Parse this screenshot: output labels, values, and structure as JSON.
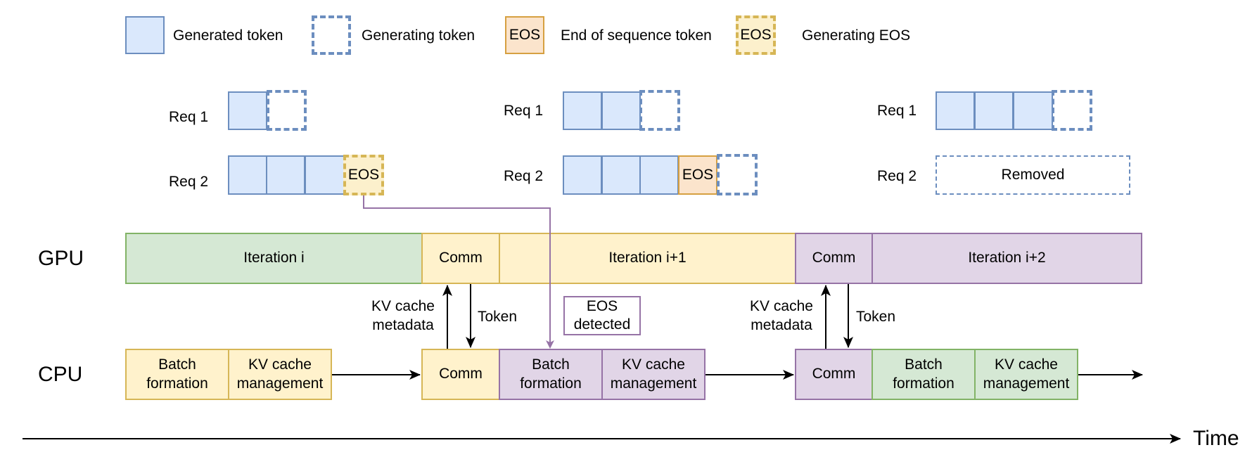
{
  "legend": {
    "items": [
      {
        "symbol_text": "",
        "label": "Generated token"
      },
      {
        "symbol_text": "",
        "label": "Generating token"
      },
      {
        "symbol_text": "EOS",
        "label": "End of sequence token"
      },
      {
        "symbol_text": "EOS",
        "label": "Generating EOS"
      }
    ]
  },
  "snapshots": [
    {
      "req1": {
        "label": "Req 1",
        "generated": 1,
        "generating": true
      },
      "req2": {
        "label": "Req 2",
        "generated": 3,
        "eos_text": "EOS",
        "eos_state": "generating"
      }
    },
    {
      "req1": {
        "label": "Req 1",
        "generated": 2,
        "generating": true
      },
      "req2": {
        "label": "Req 2",
        "generated": 3,
        "eos_text": "EOS",
        "eos_state": "generated",
        "generating": true
      }
    },
    {
      "req1": {
        "label": "Req 1",
        "generated": 3,
        "generating": true
      },
      "req2": {
        "label": "Req 2",
        "removed_text": "Removed"
      }
    }
  ],
  "lanes": {
    "gpu": {
      "label": "GPU",
      "blocks": [
        "Iteration i",
        "Comm",
        "Iteration i+1",
        "Comm",
        "Iteration i+2"
      ]
    },
    "cpu": {
      "label": "CPU",
      "blocks": [
        "Batch formation",
        "KV cache management",
        "Comm",
        "Batch formation",
        "KV cache management",
        "Comm",
        "Batch formation",
        "KV cache management"
      ]
    }
  },
  "annotations": {
    "kv_metadata_1": "KV cache metadata",
    "token_1": "Token",
    "eos_detected": "EOS detected",
    "kv_metadata_2": "KV cache metadata",
    "token_2": "Token"
  },
  "time_axis": {
    "label": "Time"
  },
  "colors": {
    "token_fill": "#dae8fc",
    "token_stroke": "#6c8ebf",
    "eos_fill": "#fbe4cc",
    "eos_stroke": "#d6a041",
    "gen_eos_fill": "#fcf0cc",
    "gen_eos_stroke": "#d6b656",
    "green_fill": "#d5e8d4",
    "green_stroke": "#82b366",
    "yellow_fill": "#fff2cc",
    "yellow_stroke": "#d6b656",
    "purple_fill": "#e1d5e7",
    "purple_stroke": "#9673a6"
  }
}
